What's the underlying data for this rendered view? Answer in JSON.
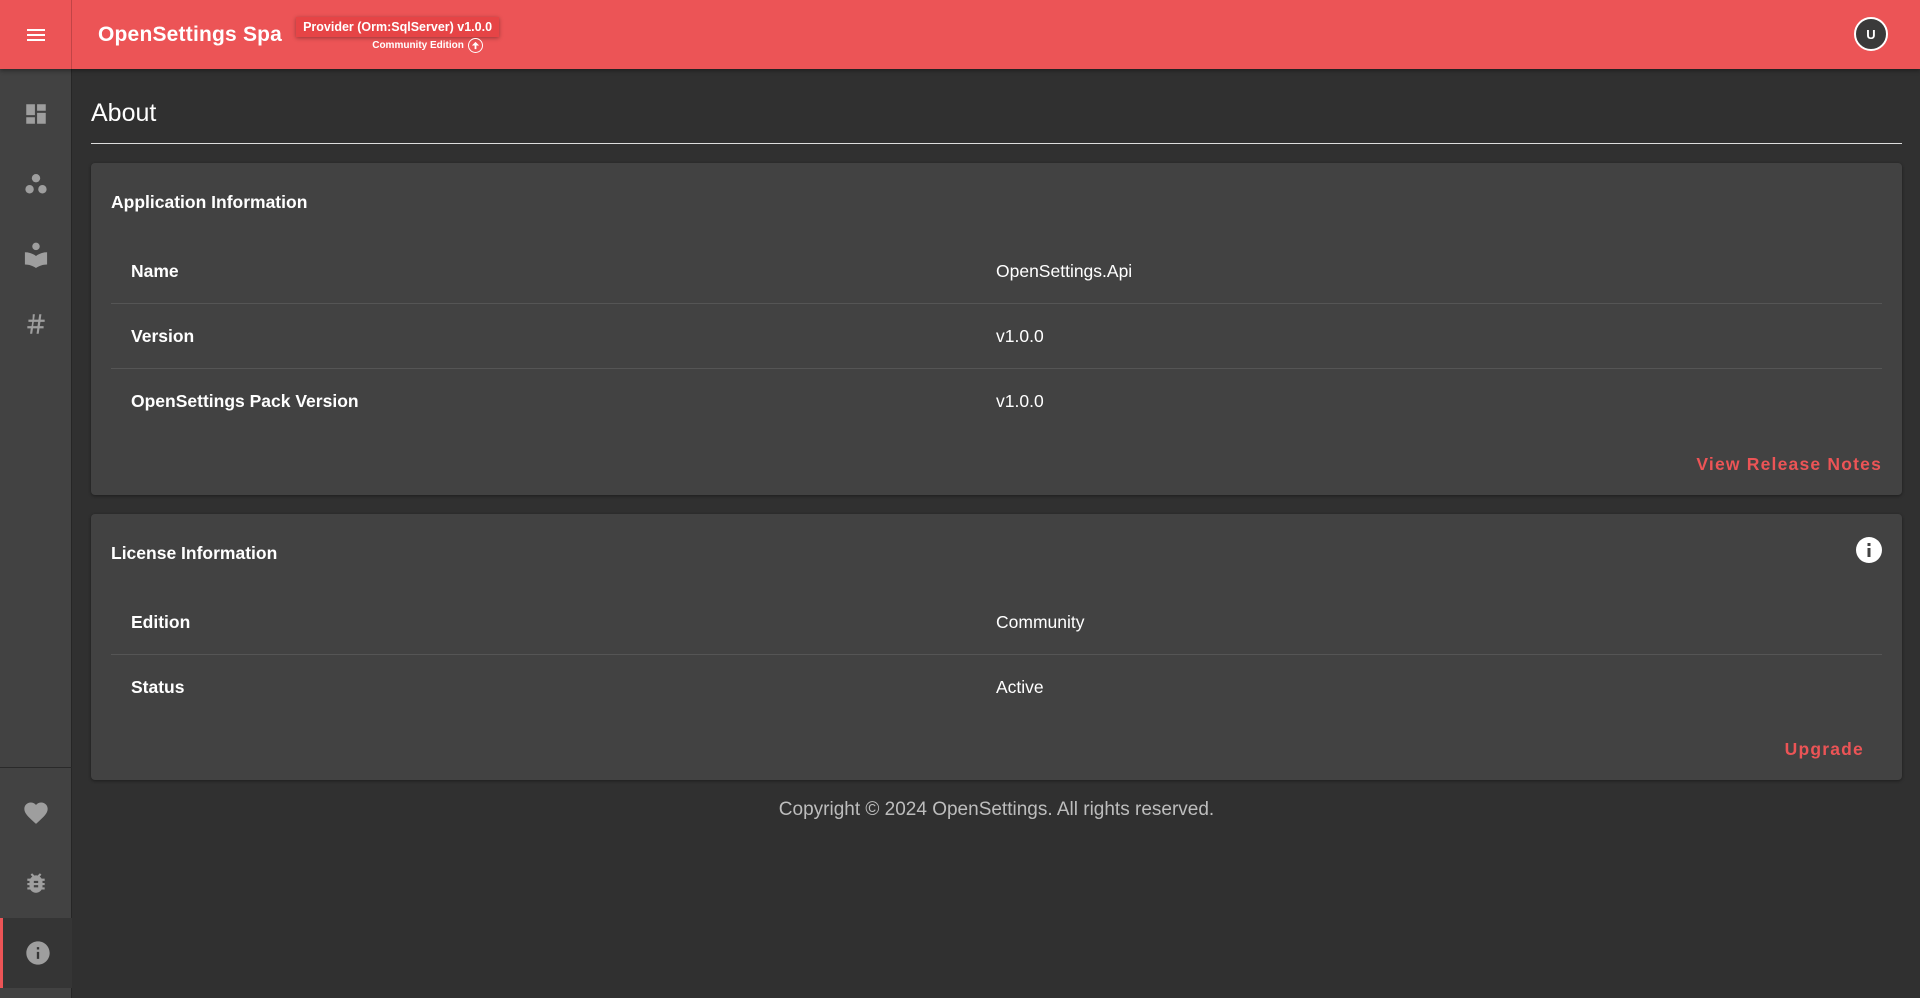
{
  "colors": {
    "accent": "#ec5456",
    "background": "#303030",
    "card": "#424242",
    "sidebar": "#424242"
  },
  "header": {
    "menu_icon": "hamburger-menu-icon",
    "title": "OpenSettings Spa",
    "provider_badge": "Provider (Orm:SqlServer) v1.0.0",
    "edition": "Community Edition",
    "avatar_initial": "U"
  },
  "sidebar": {
    "items": [
      {
        "icon": "dashboard-icon"
      },
      {
        "icon": "apps-group-icon"
      },
      {
        "icon": "reader-icon"
      },
      {
        "icon": "hash-icon"
      }
    ],
    "bottom_items": [
      {
        "icon": "heart-icon"
      },
      {
        "icon": "bug-icon"
      },
      {
        "icon": "info-icon",
        "active": true
      }
    ]
  },
  "page": {
    "title": "About"
  },
  "application_info": {
    "title": "Application Information",
    "rows": [
      {
        "label": "Name",
        "value": "OpenSettings.Api"
      },
      {
        "label": "Version",
        "value": "v1.0.0"
      },
      {
        "label": "OpenSettings Pack Version",
        "value": "v1.0.0"
      }
    ],
    "action_label": "View Release Notes"
  },
  "license_info": {
    "title": "License Information",
    "rows": [
      {
        "label": "Edition",
        "value": "Community"
      },
      {
        "label": "Status",
        "value": "Active"
      }
    ],
    "action_label": "Upgrade"
  },
  "footer": {
    "text": "Copyright © 2024 OpenSettings. All rights reserved."
  }
}
